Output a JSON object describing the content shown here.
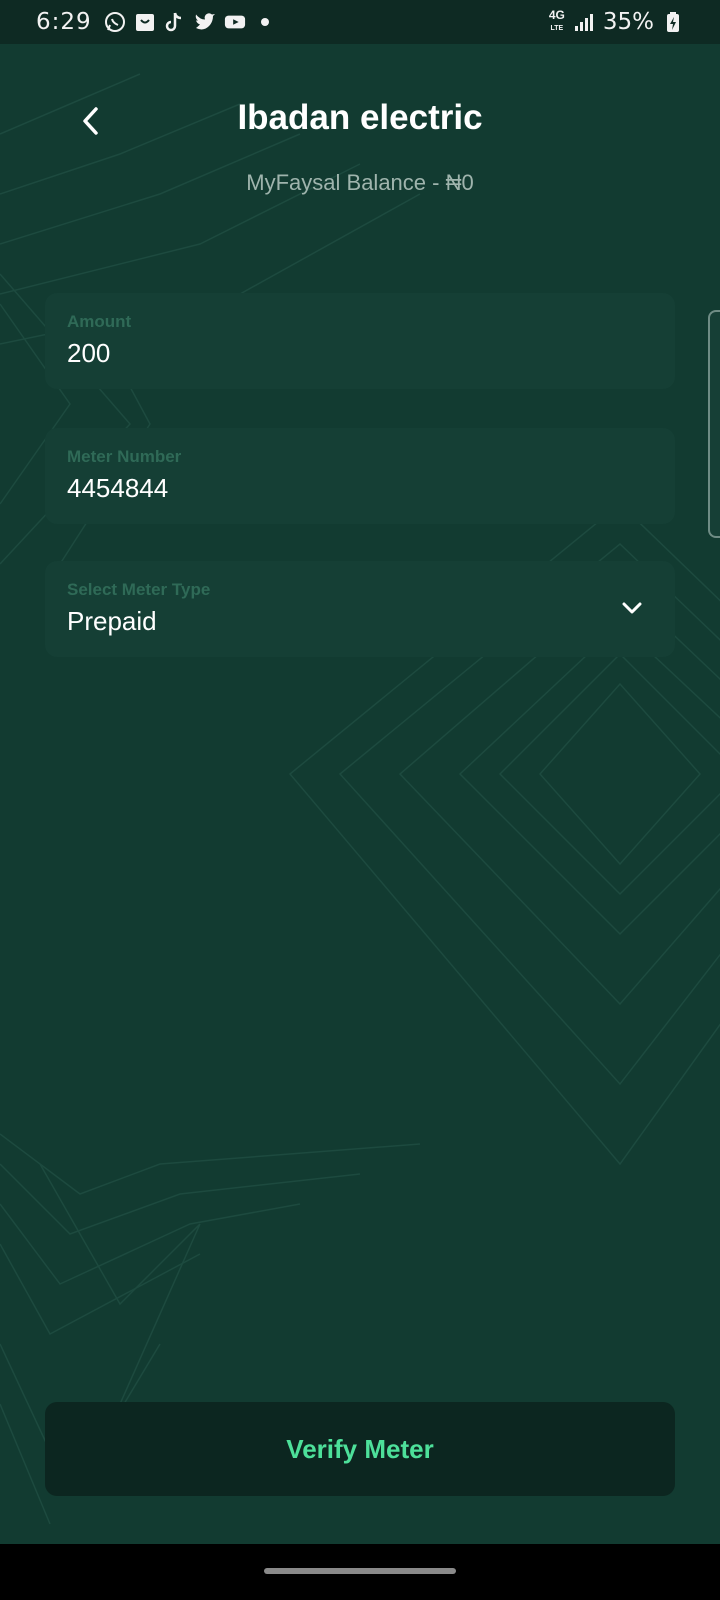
{
  "status_bar": {
    "time": "6:29",
    "left_icons": [
      "whatsapp-icon",
      "shopping-bag-icon",
      "tiktok-icon",
      "twitter-icon",
      "youtube-icon",
      "notification-dot-icon"
    ],
    "network_label_top": "4G",
    "network_label_bottom": "LTE",
    "battery": "35%"
  },
  "header": {
    "title": "Ibadan electric",
    "balance": "MyFaysal Balance - ₦0"
  },
  "form": {
    "amount": {
      "label": "Amount",
      "value": "200"
    },
    "meter_number": {
      "label": "Meter Number",
      "value": "4454844"
    },
    "meter_type": {
      "label": "Select Meter Type",
      "value": "Prepaid"
    }
  },
  "actions": {
    "verify_label": "Verify Meter"
  },
  "colors": {
    "background": "#123b31",
    "field_background": "#153f35",
    "label": "#2f6a57",
    "accent": "#4de09a",
    "button_background": "#0c2620"
  }
}
